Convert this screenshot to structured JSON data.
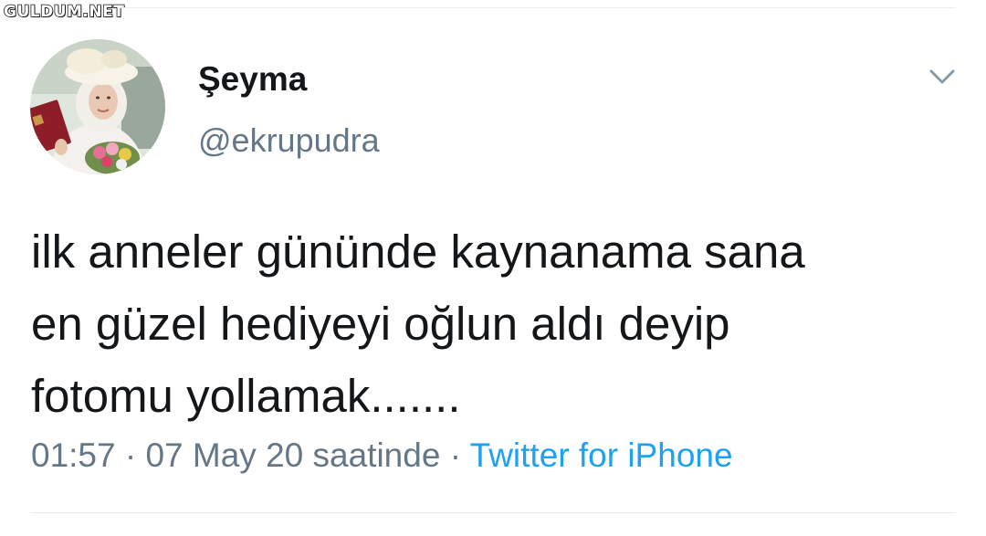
{
  "watermark": {
    "text": "GULDUM.NET"
  },
  "tweet": {
    "author": {
      "display_name": "Şeyma",
      "handle": "@ekrupudra"
    },
    "text": "ilk anneler gününde kaynanama sana\nen güzel hediyeyi oğlun aldı deyip\nfotomu yollamak.......",
    "timestamp": "01:57 · 07 May 20 saatinde",
    "separator": " · ",
    "source": "Twitter for iPhone"
  },
  "icons": {
    "menu": "chevron-down-icon"
  },
  "colors": {
    "text_primary": "#14171a",
    "text_secondary": "#657786",
    "link": "#1da1f2",
    "divider": "#e6ecf0",
    "chevron": "#8899a6"
  }
}
